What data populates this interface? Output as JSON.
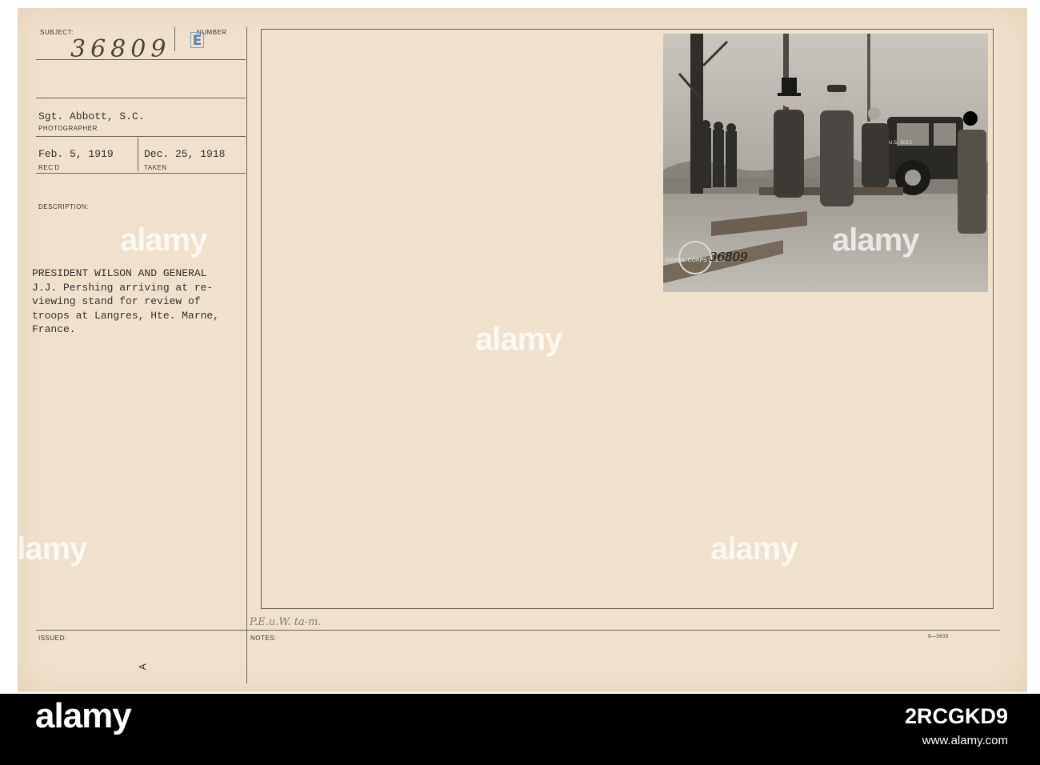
{
  "card": {
    "subject_label": "SUBJECT:",
    "number_label": "NUMBER",
    "subject_number": "36809",
    "number_stamp": "E",
    "photographer_value": "Sgt. Abbott, S.C.",
    "photographer_label": "PHOTOGRAPHER",
    "received_value": "Feb. 5, 1919",
    "received_label": "REC'D",
    "taken_value": "Dec. 25, 1918",
    "taken_label": "TAKEN",
    "description_label": "DESCRIPTION:",
    "description_text": "PRESIDENT WILSON AND GENERAL\nJ.J. Pershing arriving at re-\nviewing stand for review of\ntroops at Langres, Hte. Marne,\nFrance.",
    "issued_label": "ISSUED:",
    "notes_label": "NOTES:",
    "notes_handwriting": "P.E.u.W. ta-m.",
    "form_number": "9—5605",
    "margin_mark": "A"
  },
  "photo": {
    "stamp_text": "SIGNAL CORPS U.S.A.",
    "negative_number": "36809",
    "vehicle_plate": "U.S. 3012"
  },
  "watermark": {
    "text": "alamy"
  },
  "footer": {
    "logo": "alamy",
    "image_id": "2RCGKD9",
    "url": "www.alamy.com"
  }
}
